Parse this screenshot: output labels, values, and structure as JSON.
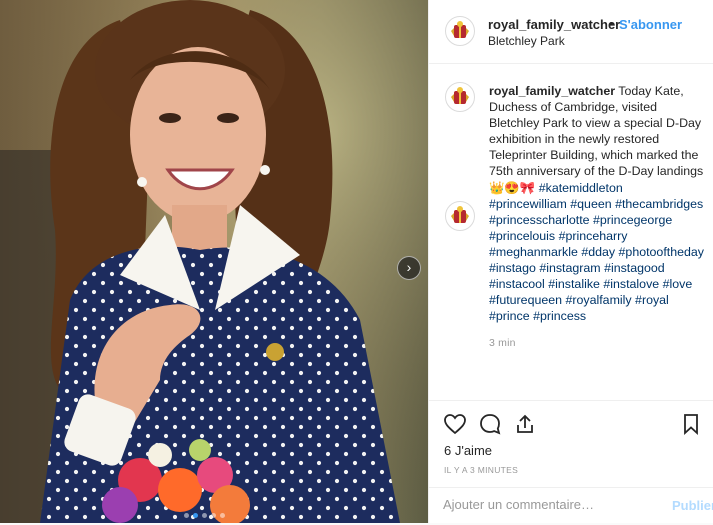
{
  "post": {
    "username": "royal_family_watcher",
    "separator": "•",
    "follow_label": "S'abonner",
    "location": "Bletchley Park"
  },
  "caption": {
    "username": "royal_family_watcher",
    "text": " Today Kate, Duchess of Cambridge, visited Bletchley Park to view a special D-Day exhibition in the newly restored Teleprinter Building, which marked the 75th anniversary of the D-Day landings 👑😍🎀 ",
    "tags": [
      "#katemiddleton",
      "#princewilliam",
      "#queen",
      "#thecambridges",
      "#princesscharlotte",
      "#princegeorge",
      "#princelouis",
      "#princeharry",
      "#meghanmarkle",
      "#dday",
      "#photooftheday",
      "#instago",
      "#instagram",
      "#instagood",
      "#instacool",
      "#instalike",
      "#instalove",
      "#love",
      "#futurequeen",
      "#royalfamily",
      "#royal",
      "#prince",
      "#princess"
    ],
    "time": "3 min"
  },
  "actions": {
    "likes": "6 J'aime",
    "ago": "IL Y A 3 MINUTES"
  },
  "comment": {
    "placeholder": "Ajouter un commentaire…",
    "publish_label": "Publier"
  },
  "icons": {
    "heart": "heart-icon",
    "comment": "comment-icon",
    "share": "share-icon",
    "save": "bookmark-icon",
    "next": "chevron-right-icon"
  },
  "colors": {
    "accent": "#3897f0",
    "hashtag": "#003569",
    "muted": "#999999",
    "dress": "#1d2c5e"
  },
  "carousel": {
    "slides": 5,
    "active_slide": 2
  }
}
